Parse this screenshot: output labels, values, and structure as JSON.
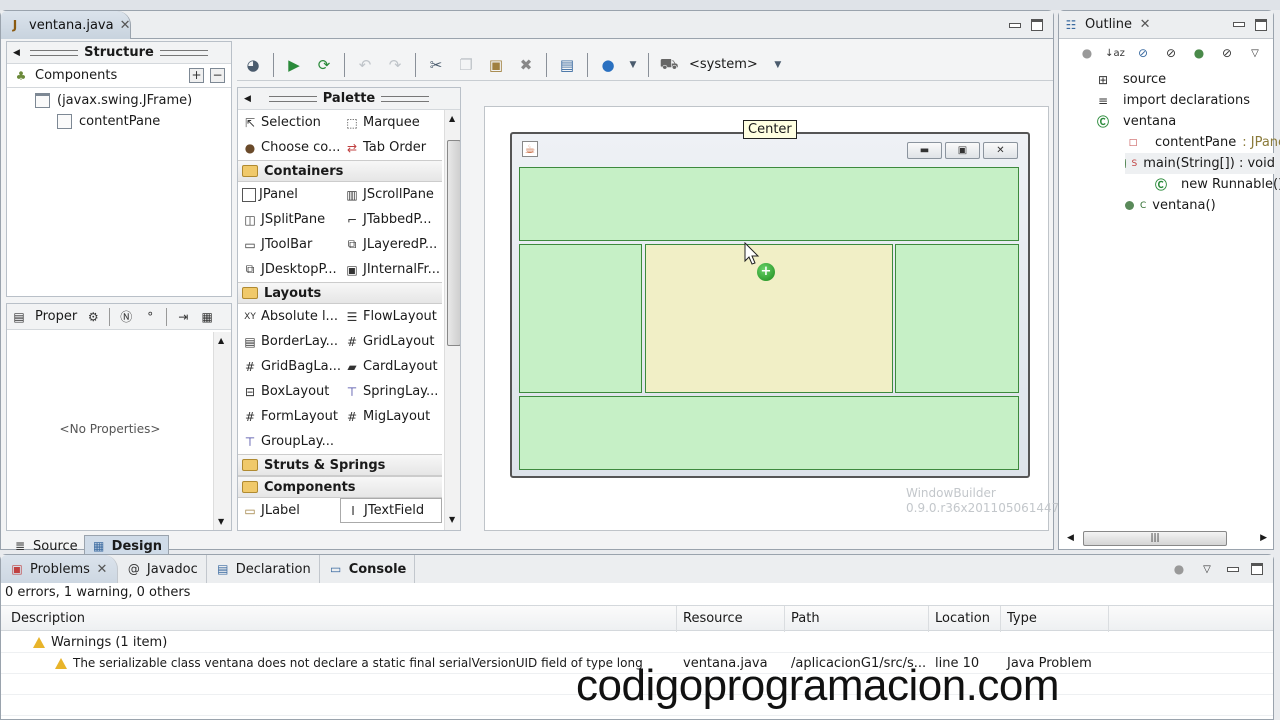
{
  "editor": {
    "tab_label": "ventana.java",
    "structure": {
      "title": "Structure",
      "components_label": "Components",
      "tree": [
        {
          "label": "(javax.swing.JFrame)"
        },
        {
          "label": "contentPane"
        }
      ]
    },
    "properties": {
      "title": "Proper",
      "empty_text": "<No Properties>"
    },
    "bottom_tabs": [
      {
        "label": "Source",
        "active": false
      },
      {
        "label": "Design",
        "active": true
      }
    ],
    "toolbar": {
      "laf_selector": "<system>"
    },
    "palette": {
      "title": "Palette",
      "tools": [
        "Selection",
        "Marquee",
        "Choose co...",
        "Tab Order"
      ],
      "categories": [
        {
          "name": "Containers",
          "items": [
            "JPanel",
            "JScrollPane",
            "JSplitPane",
            "JTabbedP...",
            "JToolBar",
            "JLayeredP...",
            "JDesktopP...",
            "JInternalFr..."
          ]
        },
        {
          "name": "Layouts",
          "items": [
            "Absolute l...",
            "FlowLayout",
            "BorderLay...",
            "GridLayout",
            "GridBagLa...",
            "CardLayout",
            "BoxLayout",
            "SpringLay...",
            "FormLayout",
            "MigLayout",
            "GroupLay..."
          ]
        },
        {
          "name": "Struts & Springs",
          "items": []
        },
        {
          "name": "Components",
          "items": [
            "JLabel",
            "JTextField"
          ]
        }
      ]
    },
    "design": {
      "tooltip": "Center",
      "regions": [
        "North",
        "West",
        "Center",
        "East",
        "South"
      ],
      "highlighted_region": "Center",
      "version_label_1": "WindowBuilder",
      "version_label_2": "0.9.0.r36x201105061447"
    }
  },
  "outline": {
    "tab_label": "Outline",
    "items": [
      {
        "label": "source",
        "icon": "package-grid-icon"
      },
      {
        "label": "import declarations",
        "icon": "imports-icon"
      },
      {
        "label": "ventana",
        "icon": "class-icon"
      },
      {
        "label": "contentPane",
        "type": " : JPane",
        "icon": "private-field-icon"
      },
      {
        "label": "main(String[]) : void",
        "icon": "public-method-icon",
        "modifier": "S"
      },
      {
        "label": "new Runnable()",
        "icon": "anonymous-class-icon"
      },
      {
        "label": "ventana()",
        "icon": "constructor-icon",
        "modifier": "C"
      }
    ]
  },
  "problems": {
    "tabs": [
      {
        "label": "Problems",
        "active": true
      },
      {
        "label": "Javadoc",
        "active": false
      },
      {
        "label": "Declaration",
        "active": false
      },
      {
        "label": "Console",
        "active": false
      }
    ],
    "summary": "0 errors, 1 warning, 0 others",
    "columns": [
      "Description",
      "Resource",
      "Path",
      "Location",
      "Type"
    ],
    "group": "Warnings (1 item)",
    "rows": [
      {
        "description": "The serializable class ventana does not declare a static final serialVersionUID field of type long",
        "resource": "ventana.java",
        "path": "/aplicacionG1/src/s...",
        "location": "line 10",
        "type": "Java Problem"
      }
    ]
  },
  "watermark": "codigoprogramacion.com",
  "colors": {
    "region_green": "#c6f0c6",
    "region_center": "#f1efc6",
    "region_border": "#3d8a3d"
  }
}
